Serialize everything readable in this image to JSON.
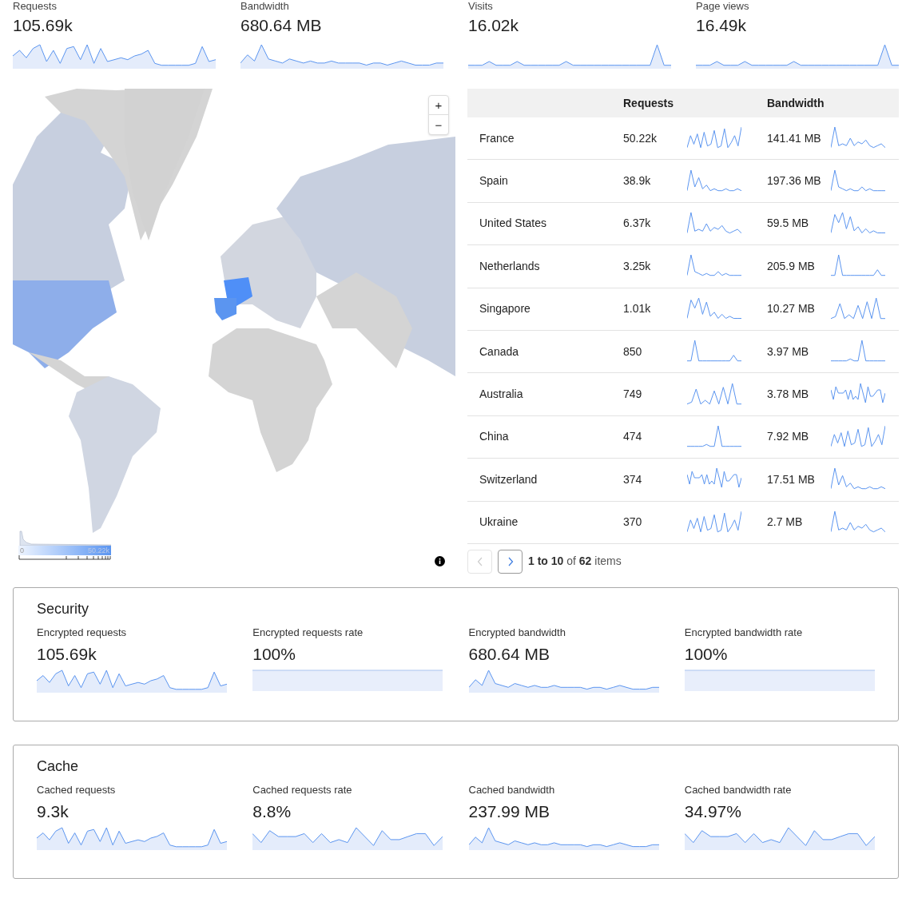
{
  "summary": [
    {
      "label": "Requests",
      "value": "105.69k"
    },
    {
      "label": "Bandwidth",
      "value": "680.64 MB"
    },
    {
      "label": "Visits",
      "value": "16.02k"
    },
    {
      "label": "Page views",
      "value": "16.49k"
    }
  ],
  "map": {
    "zoom_in": "+",
    "zoom_out": "−",
    "legend_min": "0",
    "legend_max": "50.22k"
  },
  "table": {
    "columns": [
      "Requests",
      "Bandwidth"
    ],
    "rows": [
      {
        "country": "France",
        "requests": "50.22k",
        "bandwidth": "141.41 MB"
      },
      {
        "country": "Spain",
        "requests": "38.9k",
        "bandwidth": "197.36 MB"
      },
      {
        "country": "United States",
        "requests": "6.37k",
        "bandwidth": "59.5 MB"
      },
      {
        "country": "Netherlands",
        "requests": "3.25k",
        "bandwidth": "205.9 MB"
      },
      {
        "country": "Singapore",
        "requests": "1.01k",
        "bandwidth": "10.27 MB"
      },
      {
        "country": "Canada",
        "requests": "850",
        "bandwidth": "3.97 MB"
      },
      {
        "country": "Australia",
        "requests": "749",
        "bandwidth": "3.78 MB"
      },
      {
        "country": "China",
        "requests": "474",
        "bandwidth": "7.92 MB"
      },
      {
        "country": "Switzerland",
        "requests": "374",
        "bandwidth": "17.51 MB"
      },
      {
        "country": "Ukraine",
        "requests": "370",
        "bandwidth": "2.7 MB"
      }
    ],
    "pagination": {
      "prev_disabled": true,
      "next_disabled": false,
      "status": "**1 to 10** of **62** items"
    }
  },
  "sections": [
    {
      "title": "Security",
      "metrics": [
        {
          "label": "Encrypted requests",
          "value": "105.69k",
          "kind": "wave"
        },
        {
          "label": "Encrypted requests rate",
          "value": "100%",
          "kind": "flat"
        },
        {
          "label": "Encrypted bandwidth",
          "value": "680.64 MB",
          "kind": "wave"
        },
        {
          "label": "Encrypted bandwidth rate",
          "value": "100%",
          "kind": "flat"
        }
      ]
    },
    {
      "title": "Cache",
      "metrics": [
        {
          "label": "Cached requests",
          "value": "9.3k",
          "kind": "wave"
        },
        {
          "label": "Cached requests rate",
          "value": "8.8%",
          "kind": "wave"
        },
        {
          "label": "Cached bandwidth",
          "value": "237.99 MB",
          "kind": "wave"
        },
        {
          "label": "Cached bandwidth rate",
          "value": "34.97%",
          "kind": "wave"
        }
      ]
    }
  ]
}
